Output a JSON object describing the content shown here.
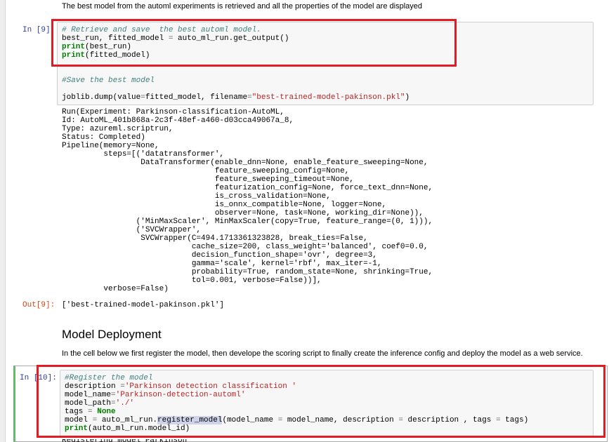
{
  "intro_text": "The best model from the automl experiments is retrieved and all the properties of the model are displayed",
  "cell9": {
    "in_prompt": "In [9]:",
    "code_lines": [
      [
        {
          "t": "# Retrieve and save  the best automl model.",
          "c": "cm"
        }
      ],
      [
        {
          "t": "best_run, fitted_model "
        },
        {
          "t": "=",
          "c": "op"
        },
        {
          "t": " auto_ml_run.get_output()"
        }
      ],
      [
        {
          "t": "print",
          "c": "kw"
        },
        {
          "t": "(best_run)"
        }
      ],
      [
        {
          "t": "print",
          "c": "kw"
        },
        {
          "t": "(fitted_model)"
        }
      ],
      [
        {
          "t": ""
        }
      ],
      [
        {
          "t": ""
        }
      ],
      [
        {
          "t": "#Save the best model",
          "c": "cm"
        }
      ],
      [
        {
          "t": ""
        }
      ],
      [
        {
          "t": "joblib.dump(value"
        },
        {
          "t": "=",
          "c": "op"
        },
        {
          "t": "fitted_model, filename"
        },
        {
          "t": "=",
          "c": "op"
        },
        {
          "t": "\"best-trained-model-pakinson.pkl\"",
          "c": "st"
        },
        {
          "t": ")"
        }
      ]
    ],
    "stdout": "Run(Experiment: Parkinson-classification-AutoML,\nId: AutoML_401b868a-2c3f-48ef-a460-d03cca49067a_8,\nType: azureml.scriptrun,\nStatus: Completed)\nPipeline(memory=None,\n         steps=[('datatransformer',\n                 DataTransformer(enable_dnn=None, enable_feature_sweeping=None,\n                                 feature_sweeping_config=None,\n                                 feature_sweeping_timeout=None,\n                                 featurization_config=None, force_text_dnn=None,\n                                 is_cross_validation=None,\n                                 is_onnx_compatible=None, logger=None,\n                                 observer=None, task=None, working_dir=None)),\n                ('MinMaxScaler', MinMaxScaler(copy=True, feature_range=(0, 1))),\n                ('SVCWrapper',\n                 SVCWrapper(C=494.1713361323828, break_ties=False,\n                            cache_size=200, class_weight='balanced', coef0=0.0,\n                            decision_function_shape='ovr', degree=3,\n                            gamma='scale', kernel='rbf', max_iter=-1,\n                            probability=True, random_state=None, shrinking=True,\n                            tol=0.001, verbose=False))],\n         verbose=False)",
    "out_prompt": "Out[9]:",
    "out_value": "['best-trained-model-pakinson.pkl']"
  },
  "section_heading": "Model Deployment",
  "section_text": "In the cell below we first register the model, then develope the scoring script to finally create the inference config and deploy the model as a web service.",
  "cell10": {
    "in_prompt": "In [10]:",
    "code_lines": [
      [
        {
          "t": "#Register the model",
          "c": "cm"
        }
      ],
      [
        {
          "t": "description "
        },
        {
          "t": "=",
          "c": "op"
        },
        {
          "t": "'Parkinson detection classification '",
          "c": "st"
        }
      ],
      [
        {
          "t": "model_name"
        },
        {
          "t": "=",
          "c": "op"
        },
        {
          "t": "'Parkinson-detection-automl'",
          "c": "st"
        }
      ],
      [
        {
          "t": "model_path"
        },
        {
          "t": "=",
          "c": "op"
        },
        {
          "t": "'./'",
          "c": "st"
        }
      ],
      [
        {
          "t": "tags "
        },
        {
          "t": "=",
          "c": "op"
        },
        {
          "t": " "
        },
        {
          "t": "None",
          "c": "kw"
        }
      ],
      [
        {
          "t": "model "
        },
        {
          "t": "=",
          "c": "op"
        },
        {
          "t": " auto_ml_run."
        },
        {
          "t": "register_model",
          "c": "hl"
        },
        {
          "t": "(model_name "
        },
        {
          "t": "=",
          "c": "op"
        },
        {
          "t": " model_name, description "
        },
        {
          "t": "=",
          "c": "op"
        },
        {
          "t": " description , tags "
        },
        {
          "t": "=",
          "c": "op"
        },
        {
          "t": " tags)"
        }
      ],
      [
        {
          "t": "print",
          "c": "kw"
        },
        {
          "t": "(auto_ml_run.model_id)"
        }
      ]
    ],
    "cut_text": "Registering model Parkinson"
  },
  "colors": {
    "highlight_box": "#e31b23",
    "active_cell_bar": "#66bb6a",
    "in_prompt": "#303f9f",
    "out_prompt": "#d84315"
  }
}
